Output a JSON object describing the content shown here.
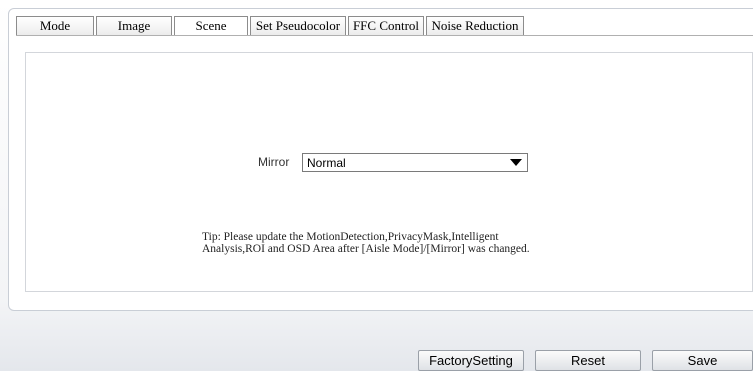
{
  "tabs": [
    {
      "label": "Mode"
    },
    {
      "label": "Image"
    },
    {
      "label": "Scene"
    },
    {
      "label": "Set Pseudocolor"
    },
    {
      "label": "FFC Control"
    },
    {
      "label": "Noise Reduction"
    }
  ],
  "active_tab": "Scene",
  "mirror": {
    "label": "Mirror",
    "selected": "Normal"
  },
  "tip": {
    "line1": "Tip: Please update the MotionDetection,PrivacyMask,Intelligent",
    "line2": "Analysis,ROI and OSD Area after [Aisle Mode]/[Mirror] was changed."
  },
  "buttons": {
    "factory": "FactorySetting",
    "reset": "Reset",
    "save": "Save"
  }
}
